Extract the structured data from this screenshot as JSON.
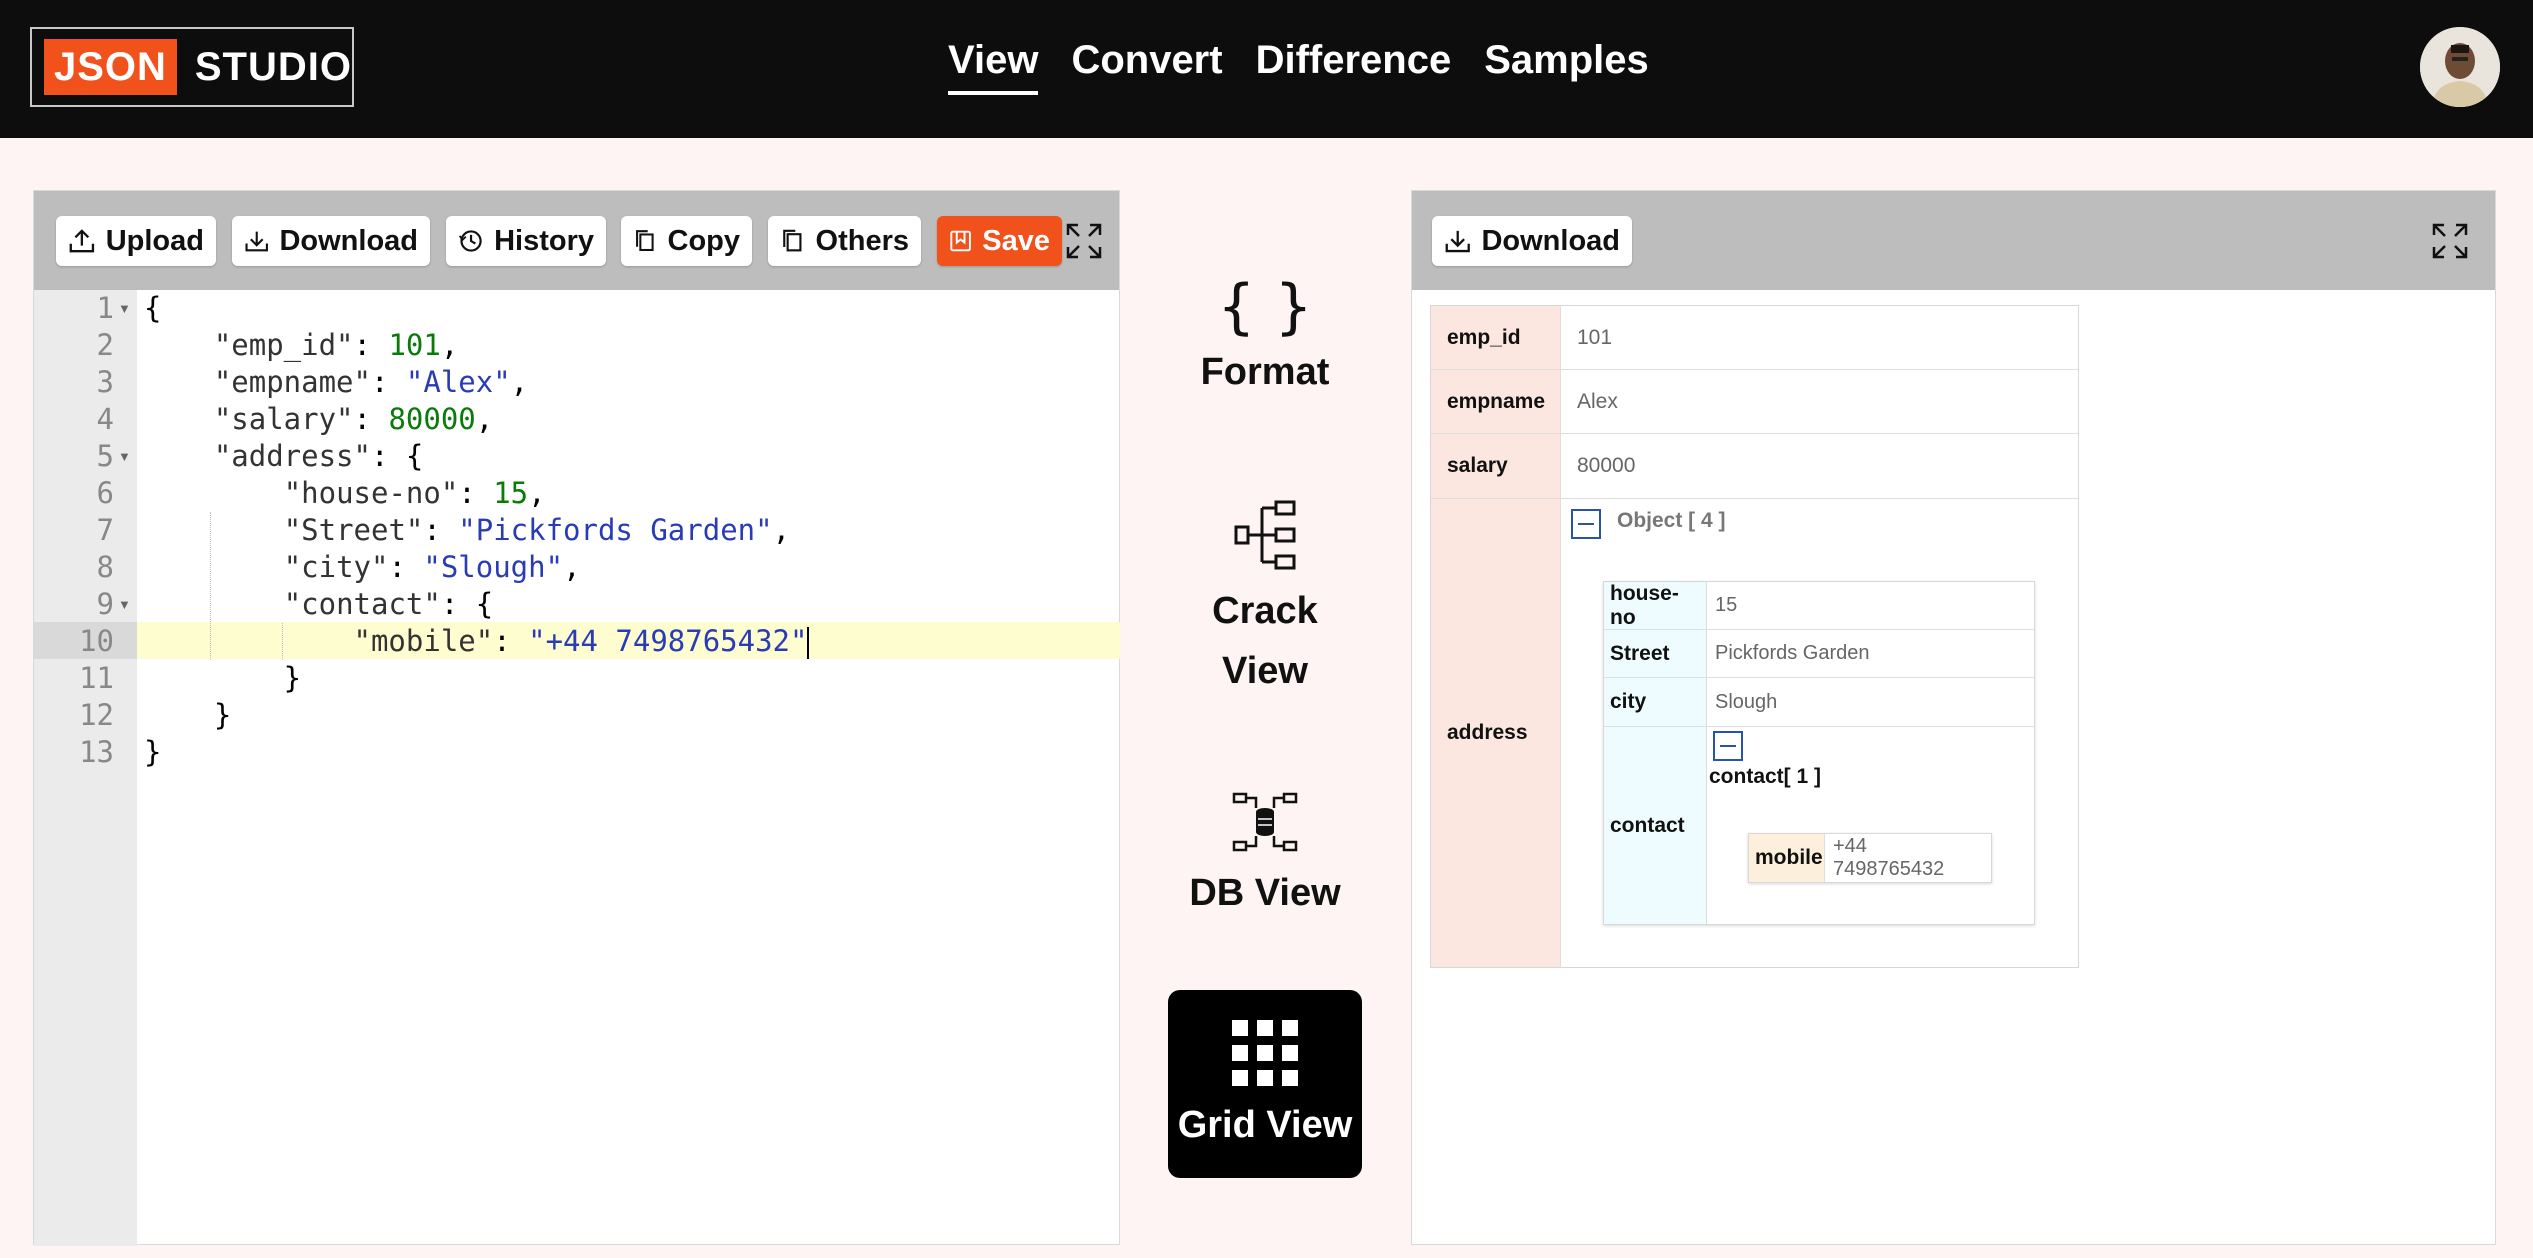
{
  "header": {
    "logo_json": "JSON",
    "logo_studio": "STUDIO",
    "nav": [
      {
        "label": "View",
        "active": true
      },
      {
        "label": "Convert",
        "active": false
      },
      {
        "label": "Difference",
        "active": false
      },
      {
        "label": "Samples",
        "active": false
      }
    ]
  },
  "editor": {
    "toolbar": {
      "upload": "Upload",
      "download": "Download",
      "history": "History",
      "copy": "Copy",
      "others": "Others",
      "save": "Save"
    },
    "line_numbers": [
      "1",
      "2",
      "3",
      "4",
      "5",
      "6",
      "7",
      "8",
      "9",
      "10",
      "11",
      "12",
      "13"
    ],
    "active_line": "10"
  },
  "views": {
    "format": {
      "icon": "{ }",
      "label": "Format"
    },
    "crack": {
      "label_line1": "Crack",
      "label_line2": "View"
    },
    "db": {
      "label": "DB View"
    },
    "grid": {
      "label": "Grid View"
    }
  },
  "grid": {
    "toolbar": {
      "download": "Download"
    },
    "rows": {
      "emp_id": {
        "key": "emp_id",
        "value": "101"
      },
      "empname": {
        "key": "empname",
        "value": "Alex"
      },
      "salary": {
        "key": "salary",
        "value": "80000"
      },
      "address": {
        "key": "address",
        "object_label": "Object [ 4 ]"
      }
    },
    "address": {
      "house_no": {
        "key": "house-no",
        "value": "15"
      },
      "street": {
        "key": "Street",
        "value": "Pickfords Garden"
      },
      "city": {
        "key": "city",
        "value": "Slough"
      },
      "contact": {
        "key": "contact",
        "label": "contact[ 1 ]"
      },
      "mobile": {
        "key": "mobile",
        "value": "+44 7498765432"
      }
    }
  },
  "colors": {
    "accent": "#f1511b",
    "header_bg": "#0d0d0d",
    "page_bg": "#fdf4f3",
    "json_number": "#0a7a0a",
    "json_string": "#2a3cb5"
  }
}
